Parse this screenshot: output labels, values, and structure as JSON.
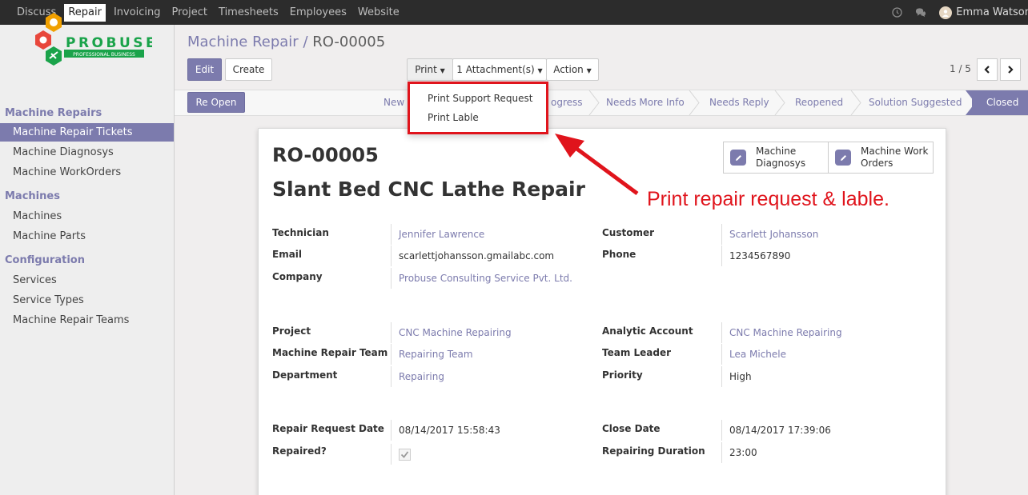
{
  "topnav": {
    "items": [
      "Discuss",
      "Repair",
      "Invoicing",
      "Project",
      "Timesheets",
      "Employees",
      "Website"
    ],
    "active": "Repair",
    "user": "Emma Watson"
  },
  "logo": {
    "name": "PROBUSE",
    "tagline": "PROFESSIONAL BUSINESS"
  },
  "sidebar": {
    "sections": [
      {
        "title": "Machine Repairs",
        "items": [
          "Machine Repair Tickets",
          "Machine Diagnosys",
          "Machine WorkOrders"
        ]
      },
      {
        "title": "Machines",
        "items": [
          "Machines",
          "Machine Parts"
        ]
      },
      {
        "title": "Configuration",
        "items": [
          "Services",
          "Service Types",
          "Machine Repair Teams"
        ]
      }
    ],
    "active_item": "Machine Repair Tickets"
  },
  "breadcrumb": {
    "parent": "Machine Repair",
    "separator": "/",
    "current": "RO-00005"
  },
  "toolbar": {
    "edit": "Edit",
    "create": "Create",
    "print": "Print",
    "attachments": "1 Attachment(s)",
    "action": "Action"
  },
  "pager": {
    "text": "1 / 5"
  },
  "print_menu": {
    "items": [
      "Print Support Request",
      "Print Lable"
    ]
  },
  "status": {
    "reopen_button": "Re Open",
    "stages": [
      "New",
      "In Progress",
      "Needs More Info",
      "Needs Reply",
      "Reopened",
      "Solution Suggested",
      "Closed"
    ],
    "stage_visible_text": [
      "New",
      "ogress",
      "Needs More Info",
      "Needs Reply",
      "Reopened",
      "Solution Suggested",
      "Closed"
    ],
    "current": "Closed"
  },
  "record": {
    "ref": "RO-00005",
    "title": "Slant Bed CNC Lathe Repair",
    "smart_buttons": [
      {
        "line1": "Machine",
        "line2": "Diagnosys",
        "icon": "pencil-icon"
      },
      {
        "line1": "Machine Work",
        "line2": "Orders",
        "icon": "pencil-icon"
      }
    ],
    "fields": {
      "technician": {
        "label": "Technician",
        "value": "Jennifer Lawrence"
      },
      "email": {
        "label": "Email",
        "value": "scarlettjohansson.gmailabc.com"
      },
      "company": {
        "label": "Company",
        "value": "Probuse Consulting Service Pvt. Ltd."
      },
      "customer": {
        "label": "Customer",
        "value": "Scarlett Johansson"
      },
      "phone": {
        "label": "Phone",
        "value": "1234567890"
      },
      "project": {
        "label": "Project",
        "value": "CNC Machine Repairing"
      },
      "team": {
        "label": "Machine Repair Team",
        "value": "Repairing Team"
      },
      "department": {
        "label": "Department",
        "value": "Repairing"
      },
      "analytic": {
        "label": "Analytic Account",
        "value": "CNC Machine Repairing"
      },
      "leader": {
        "label": "Team Leader",
        "value": "Lea Michele"
      },
      "priority": {
        "label": "Priority",
        "value": "High"
      },
      "request_date": {
        "label": "Repair Request Date",
        "value": "08/14/2017 15:58:43"
      },
      "repaired": {
        "label": "Repaired?",
        "checked": true
      },
      "close_date": {
        "label": "Close Date",
        "value": "08/14/2017 17:39:06"
      },
      "duration": {
        "label": "Repairing Duration",
        "value": "23:00"
      }
    }
  },
  "annotation": {
    "text": "Print repair request & lable."
  },
  "colors": {
    "accent": "#7c7bad",
    "annotation": "#e0141c",
    "topbar": "#2c2c2c"
  }
}
